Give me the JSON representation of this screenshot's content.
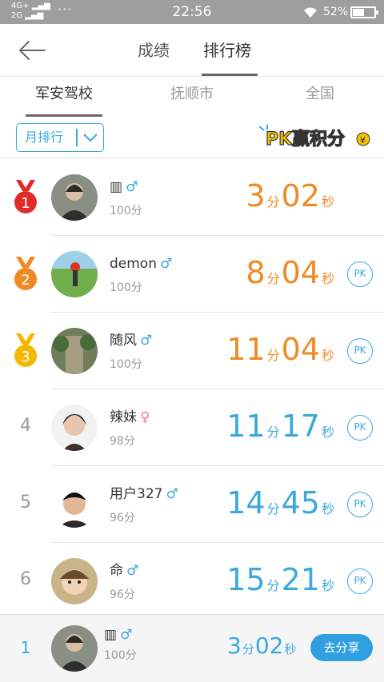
{
  "status_bar": {
    "network_top": "4G+",
    "network_bottom": "2G",
    "dots": "···",
    "time": "22:56",
    "battery": "52%",
    "battery_level": 0.52
  },
  "header": {
    "back_icon": "back-arrow-icon",
    "tabs": [
      "成绩",
      "排行榜"
    ],
    "active_tab": "排行榜"
  },
  "region_tabs": {
    "items": [
      "军安驾校",
      "抚顺市",
      "全国"
    ],
    "active": "军安驾校"
  },
  "filter": {
    "selected": "月排行",
    "chevron_icon": "chevron-down-icon",
    "pk_logo_text": "PK赢积分"
  },
  "colors": {
    "accent": "#3aa9dd",
    "orange": "#f08a24",
    "medal_gold": "#f5b800",
    "medal_silver": "#f08a24",
    "medal_red": "#e02b2b",
    "share_button": "#2f9fe0"
  },
  "rankings": [
    {
      "rank": "1",
      "name": "▥",
      "gender": "♂",
      "score": "100分",
      "minutes": "3",
      "min_unit": "分",
      "seconds": "02",
      "sec_unit": "秒",
      "pk": ""
    },
    {
      "rank": "2",
      "name": "demon",
      "gender": "♂",
      "score": "100分",
      "minutes": "8",
      "min_unit": "分",
      "seconds": "04",
      "sec_unit": "秒",
      "pk": "PK"
    },
    {
      "rank": "3",
      "name": "随风",
      "gender": "♂",
      "score": "100分",
      "minutes": "11",
      "min_unit": "分",
      "seconds": "04",
      "sec_unit": "秒",
      "pk": "PK"
    },
    {
      "rank": "4",
      "name": "辣妹",
      "gender": "♀",
      "score": "98分",
      "minutes": "11",
      "min_unit": "分",
      "seconds": "17",
      "sec_unit": "秒",
      "pk": "PK"
    },
    {
      "rank": "5",
      "name": "用户327",
      "gender": "♂",
      "score": "96分",
      "minutes": "14",
      "min_unit": "分",
      "seconds": "45",
      "sec_unit": "秒",
      "pk": "PK"
    },
    {
      "rank": "6",
      "name": "命",
      "gender": "♂",
      "score": "96分",
      "minutes": "15",
      "min_unit": "分",
      "seconds": "21",
      "sec_unit": "秒",
      "pk": "PK"
    }
  ],
  "my_entry": {
    "rank": "1",
    "name": "▥",
    "gender": "♂",
    "score": "100分",
    "minutes": "3",
    "min_unit": "分",
    "seconds": "02",
    "sec_unit": "秒",
    "share_label": "去分享"
  }
}
